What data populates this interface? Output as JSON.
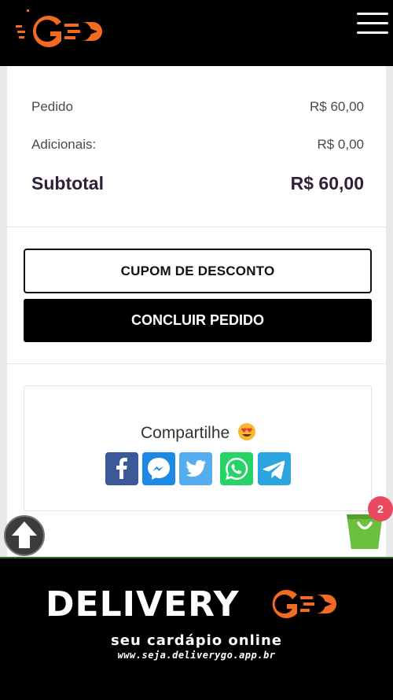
{
  "header": {
    "logo_text": "G",
    "menu_icon": "hamburger-icon"
  },
  "summary": {
    "order_label": "Pedido",
    "order_value": "R$ 60,00",
    "extras_label": "Adicionais:",
    "extras_value": "R$ 0,00",
    "subtotal_label": "Subtotal",
    "subtotal_value": "R$ 60,00"
  },
  "actions": {
    "coupon_label": "CUPOM DE DESCONTO",
    "finish_label": "CONCLUIR PEDIDO"
  },
  "share": {
    "title": "Compartilhe",
    "emoji": "heart-eyes-emoji",
    "networks": [
      {
        "name": "facebook",
        "color": "#3b5998"
      },
      {
        "name": "messenger",
        "color": "#1e88e5"
      },
      {
        "name": "twitter",
        "color": "#55acee"
      },
      {
        "name": "whatsapp",
        "color": "#25d366"
      },
      {
        "name": "telegram",
        "color": "#2ca5e0"
      }
    ]
  },
  "cart": {
    "count": "2",
    "icon": "shopping-bag-icon",
    "color": "#6abf3c"
  },
  "footer": {
    "brand_word": "DELIVERY",
    "brand_logo": "G",
    "tagline": "seu cardápio online",
    "url": "www.seja.deliverygo.app.br"
  },
  "colors": {
    "brand_orange": "#f26b22",
    "badge_red": "#e84a5f",
    "text_dark": "#2d2236"
  }
}
